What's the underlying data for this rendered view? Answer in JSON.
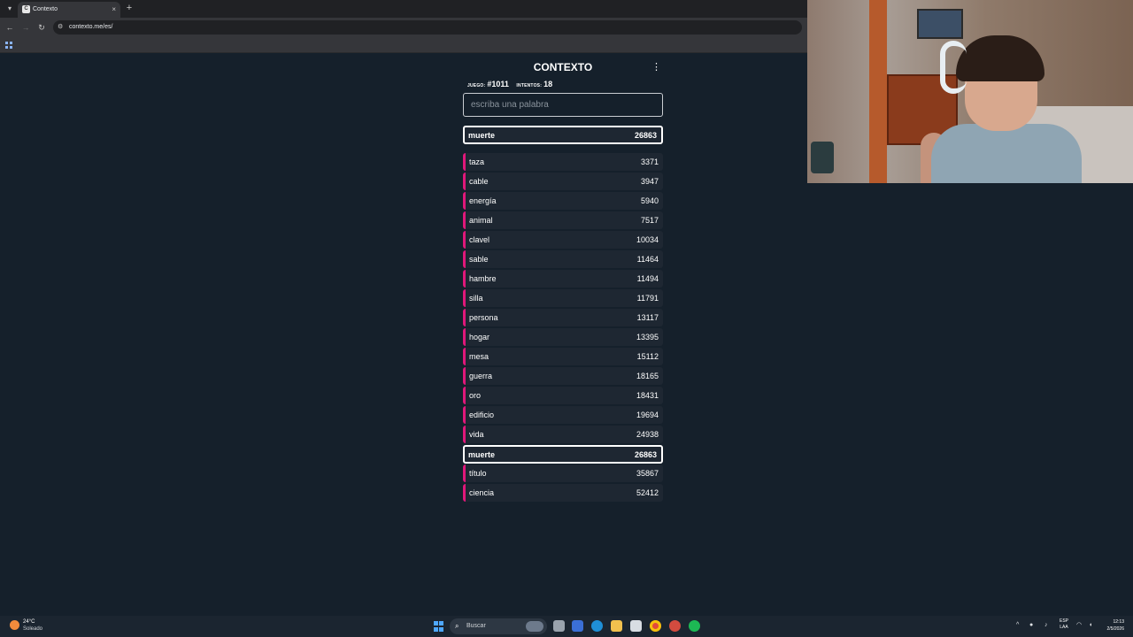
{
  "browser": {
    "tab_title": "Contexto",
    "tab_favicon": "C",
    "url": "contexto.me/es/",
    "new_tab_glyph": "+",
    "close_glyph": "×"
  },
  "game": {
    "title": "CONTEXTO",
    "menu_glyph": "⋮",
    "game_label": "JUEGO:",
    "game_number": "#1011",
    "attempts_label": "INTENTOS:",
    "attempts": "18",
    "input_placeholder": "escriba una palabra",
    "last_guess": {
      "word": "muerte",
      "rank": "26863"
    },
    "guesses": [
      {
        "word": "taza",
        "rank": "3371"
      },
      {
        "word": "cable",
        "rank": "3947"
      },
      {
        "word": "energía",
        "rank": "5940"
      },
      {
        "word": "animal",
        "rank": "7517"
      },
      {
        "word": "clavel",
        "rank": "10034"
      },
      {
        "word": "sable",
        "rank": "11464"
      },
      {
        "word": "hambre",
        "rank": "11494"
      },
      {
        "word": "silla",
        "rank": "11791"
      },
      {
        "word": "persona",
        "rank": "13117"
      },
      {
        "word": "hogar",
        "rank": "13395"
      },
      {
        "word": "mesa",
        "rank": "15112"
      },
      {
        "word": "guerra",
        "rank": "18165"
      },
      {
        "word": "oro",
        "rank": "18431"
      },
      {
        "word": "edificio",
        "rank": "19694"
      },
      {
        "word": "vida",
        "rank": "24938"
      },
      {
        "word": "muerte",
        "rank": "26863"
      },
      {
        "word": "título",
        "rank": "35867"
      },
      {
        "word": "ciencia",
        "rank": "52412"
      }
    ],
    "highlight_index": 15,
    "bar_color": "#e0187a"
  },
  "taskbar": {
    "temperature": "24°C",
    "weather": "Soleado",
    "search_label": "Buscar",
    "lang_1": "ESP",
    "lang_2": "LAA",
    "time": "12:13",
    "date": "2/5/2026"
  }
}
